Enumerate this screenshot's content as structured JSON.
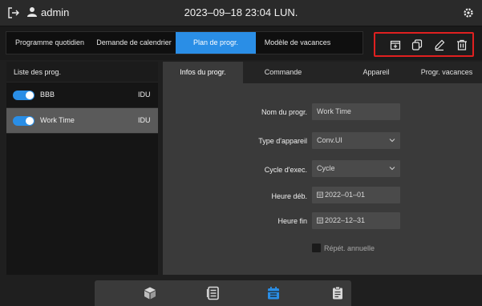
{
  "header": {
    "username": "admin",
    "datetime": "2023–09–18 23:04 LUN."
  },
  "tabs": [
    {
      "label": "Programme quotidien",
      "active": false
    },
    {
      "label": "Demande de calendrier",
      "active": false
    },
    {
      "label": "Plan de progr.",
      "active": true
    },
    {
      "label": "Modèle de vacances",
      "active": false
    }
  ],
  "actions": [
    "add-icon",
    "copy-icon",
    "edit-icon",
    "delete-icon"
  ],
  "program_list": {
    "header": "Liste des prog.",
    "items": [
      {
        "name": "BBB",
        "type": "IDU",
        "enabled": true,
        "selected": false
      },
      {
        "name": "Work Time",
        "type": "IDU",
        "enabled": true,
        "selected": true
      }
    ]
  },
  "detail_tabs": [
    {
      "label": "Infos du progr.",
      "active": true
    },
    {
      "label": "Commande",
      "active": false
    },
    {
      "label": "Appareil",
      "active": false
    },
    {
      "label": "Progr. vacances",
      "active": false
    }
  ],
  "form": {
    "name_label": "Nom du progr.",
    "name_value": "Work Time",
    "device_type_label": "Type d'appareil",
    "device_type_value": "Conv.UI",
    "cycle_label": "Cycle d'exec.",
    "cycle_value": "Cycle",
    "start_label": "Heure déb.",
    "start_value": "2022–01–01",
    "end_label": "Heure fin",
    "end_value": "2022–12–31",
    "repeat_label": "Répét. annuelle",
    "repeat_checked": false
  },
  "bottom_nav": [
    {
      "icon": "cube-icon",
      "active": false
    },
    {
      "icon": "list-icon",
      "active": false
    },
    {
      "icon": "calendar-icon",
      "active": true
    },
    {
      "icon": "clipboard-icon",
      "active": false
    }
  ],
  "colors": {
    "accent": "#2a8ee6",
    "highlight": "#e02020",
    "background": "#1f1f1f",
    "panel": "#3a3a3a"
  }
}
